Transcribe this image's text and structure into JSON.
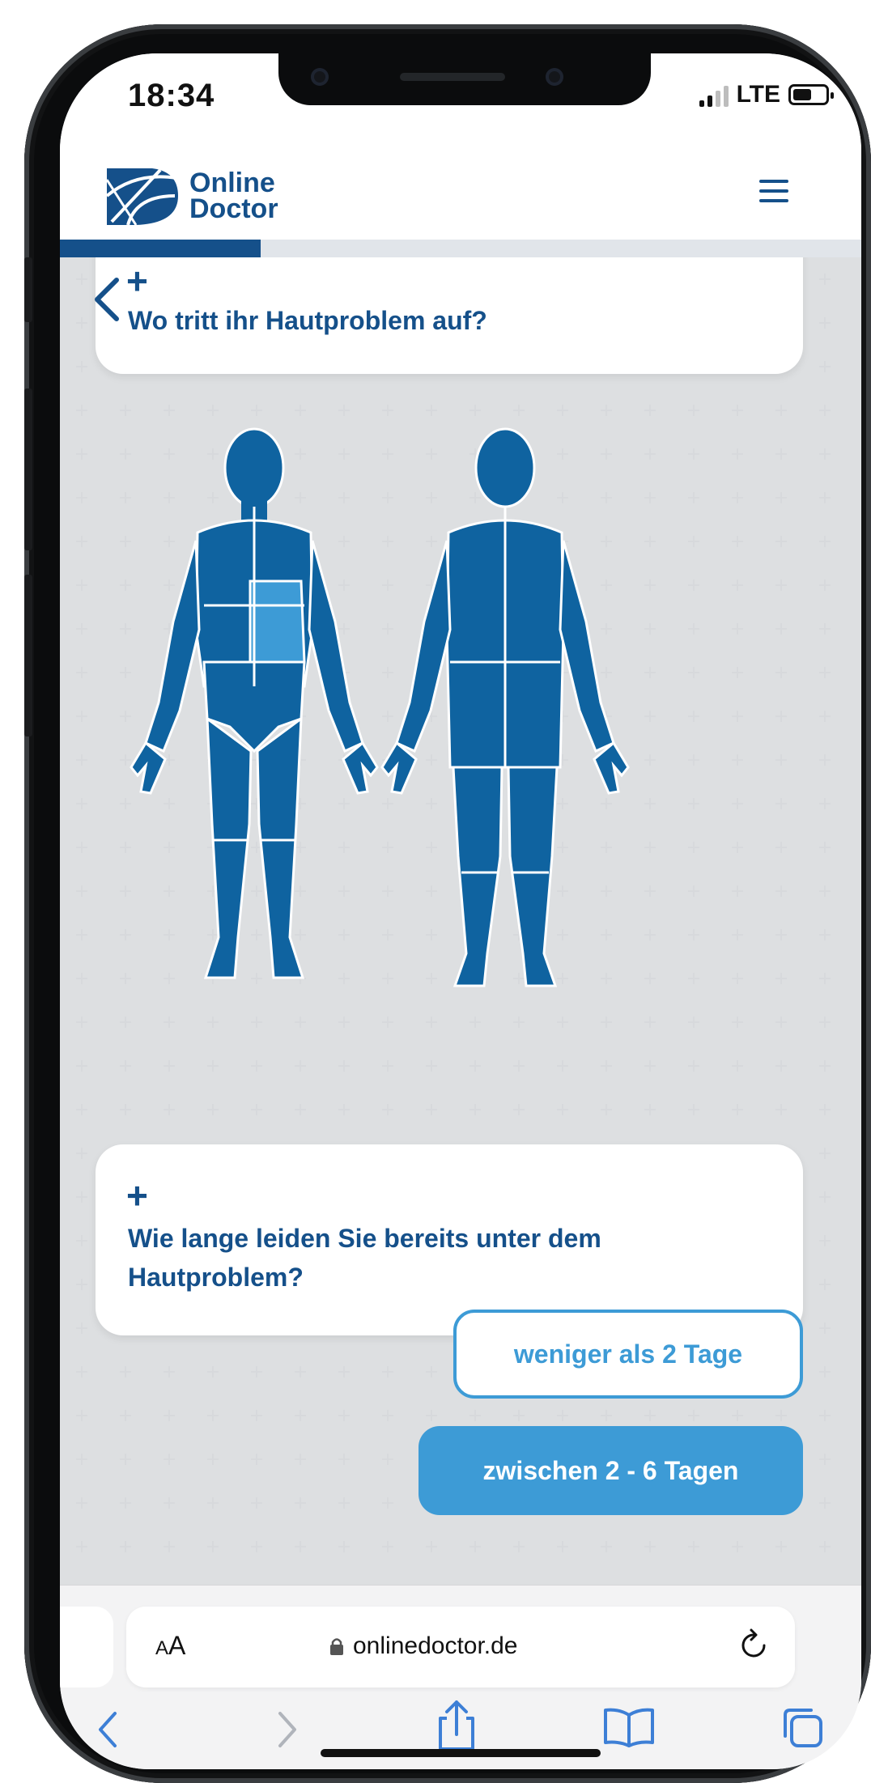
{
  "status_bar": {
    "time": "18:34",
    "network": "LTE"
  },
  "header": {
    "logo_line1": "Online",
    "logo_line2": "Doctor",
    "progress_fraction": 0.25
  },
  "questions": [
    {
      "text": "Wo tritt ihr Hautproblem auf?"
    },
    {
      "text": "Wie lange leiden Sie bereits unter dem Hautproblem?"
    }
  ],
  "body_map": {
    "selected_region": "abdomen"
  },
  "answers": [
    {
      "label": "weniger als 2 Tage",
      "style": "outline"
    },
    {
      "label": "zwischen 2 - 6 Tagen",
      "style": "filled"
    }
  ],
  "browser": {
    "text_size_label": "AA",
    "url": "onlinedoctor.de"
  },
  "colors": {
    "brand": "#15508a",
    "body": "#0f63a0",
    "highlight": "#3d9bd6",
    "background": "#ebeced"
  }
}
